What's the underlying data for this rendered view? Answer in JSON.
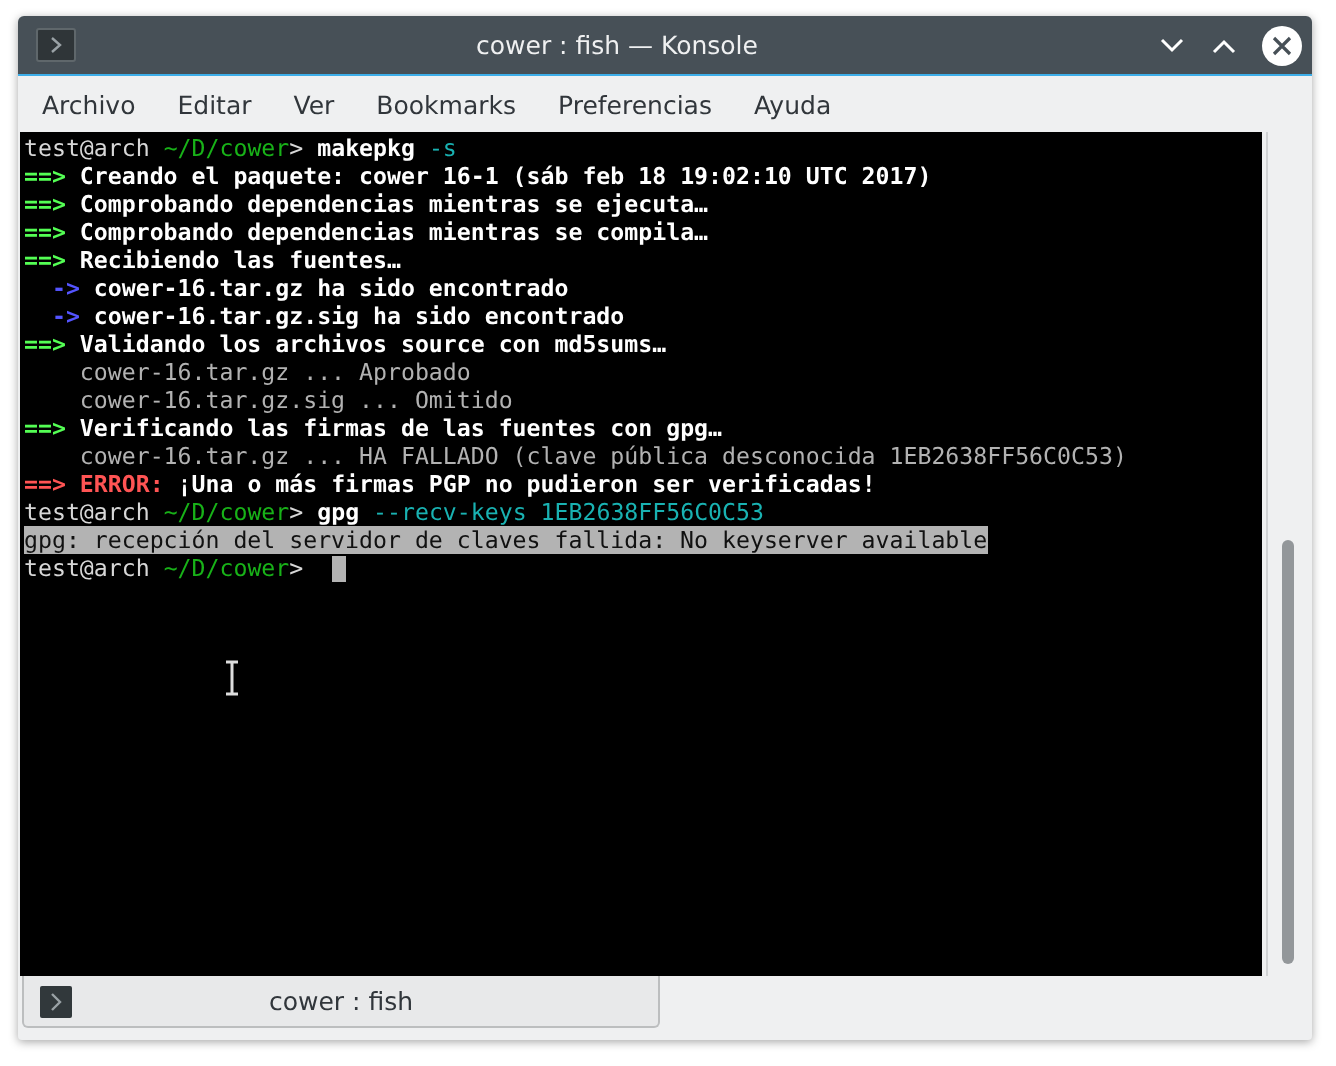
{
  "window": {
    "title": "cower : fish — Konsole"
  },
  "menu": [
    "Archivo",
    "Editar",
    "Ver",
    "Bookmarks",
    "Preferencias",
    "Ayuda"
  ],
  "terminal": {
    "lines": [
      {
        "selected": false,
        "segments": [
          {
            "kind": "prompt",
            "text": "test@arch "
          },
          {
            "kind": "path",
            "text": "~/D/cower"
          },
          {
            "kind": "prompt",
            "text": "> "
          },
          {
            "kind": "command",
            "text": "makepkg "
          },
          {
            "kind": "arg",
            "text": "-s"
          }
        ]
      },
      {
        "selected": false,
        "segments": [
          {
            "kind": "arrow",
            "text": "==> "
          },
          {
            "kind": "bold",
            "text": "Creando el paquete: cower 16-1 (sáb feb 18 19:02:10 UTC 2017)"
          }
        ]
      },
      {
        "selected": false,
        "segments": [
          {
            "kind": "arrow",
            "text": "==> "
          },
          {
            "kind": "bold",
            "text": "Comprobando dependencias mientras se ejecuta…"
          }
        ]
      },
      {
        "selected": false,
        "segments": [
          {
            "kind": "arrow",
            "text": "==> "
          },
          {
            "kind": "bold",
            "text": "Comprobando dependencias mientras se compila…"
          }
        ]
      },
      {
        "selected": false,
        "segments": [
          {
            "kind": "arrow",
            "text": "==> "
          },
          {
            "kind": "bold",
            "text": "Recibiendo las fuentes…"
          }
        ]
      },
      {
        "selected": false,
        "segments": [
          {
            "kind": "subarrow",
            "text": "  -> "
          },
          {
            "kind": "bold",
            "text": "cower-16.tar.gz ha sido encontrado"
          }
        ]
      },
      {
        "selected": false,
        "segments": [
          {
            "kind": "subarrow",
            "text": "  -> "
          },
          {
            "kind": "bold",
            "text": "cower-16.tar.gz.sig ha sido encontrado"
          }
        ]
      },
      {
        "selected": false,
        "segments": [
          {
            "kind": "arrow",
            "text": "==> "
          },
          {
            "kind": "bold",
            "text": "Validando los archivos source con md5sums…"
          }
        ]
      },
      {
        "selected": false,
        "segments": [
          {
            "kind": "plain",
            "text": "    cower-16.tar.gz ... Aprobado"
          }
        ]
      },
      {
        "selected": false,
        "segments": [
          {
            "kind": "plain",
            "text": "    cower-16.tar.gz.sig ... Omitido"
          }
        ]
      },
      {
        "selected": false,
        "segments": [
          {
            "kind": "arrow",
            "text": "==> "
          },
          {
            "kind": "bold",
            "text": "Verificando las firmas de las fuentes con gpg…"
          }
        ]
      },
      {
        "selected": false,
        "segments": [
          {
            "kind": "plain",
            "text": "    cower-16.tar.gz ... HA FALLADO (clave pública desconocida 1EB2638FF56C0C53)"
          }
        ]
      },
      {
        "selected": false,
        "segments": [
          {
            "kind": "error",
            "text": "==> ERROR:"
          },
          {
            "kind": "bold",
            "text": " ¡Una o más firmas PGP no pudieron ser verificadas!"
          }
        ]
      },
      {
        "selected": false,
        "segments": [
          {
            "kind": "prompt",
            "text": "test@arch "
          },
          {
            "kind": "path",
            "text": "~/D/cower"
          },
          {
            "kind": "prompt",
            "text": "> "
          },
          {
            "kind": "command",
            "text": "gpg "
          },
          {
            "kind": "arg",
            "text": "--recv-keys 1EB2638FF56C0C53"
          }
        ]
      },
      {
        "selected": true,
        "segments": [
          {
            "kind": "plain",
            "text": "gpg: recepción del servidor de claves fallida: No keyserver available"
          }
        ]
      },
      {
        "selected": false,
        "cursor": true,
        "segments": [
          {
            "kind": "prompt",
            "text": "test@arch "
          },
          {
            "kind": "path",
            "text": "~/D/cower"
          },
          {
            "kind": "prompt",
            "text": "> "
          }
        ]
      }
    ]
  },
  "tabs": [
    {
      "label": "cower : fish"
    }
  ]
}
